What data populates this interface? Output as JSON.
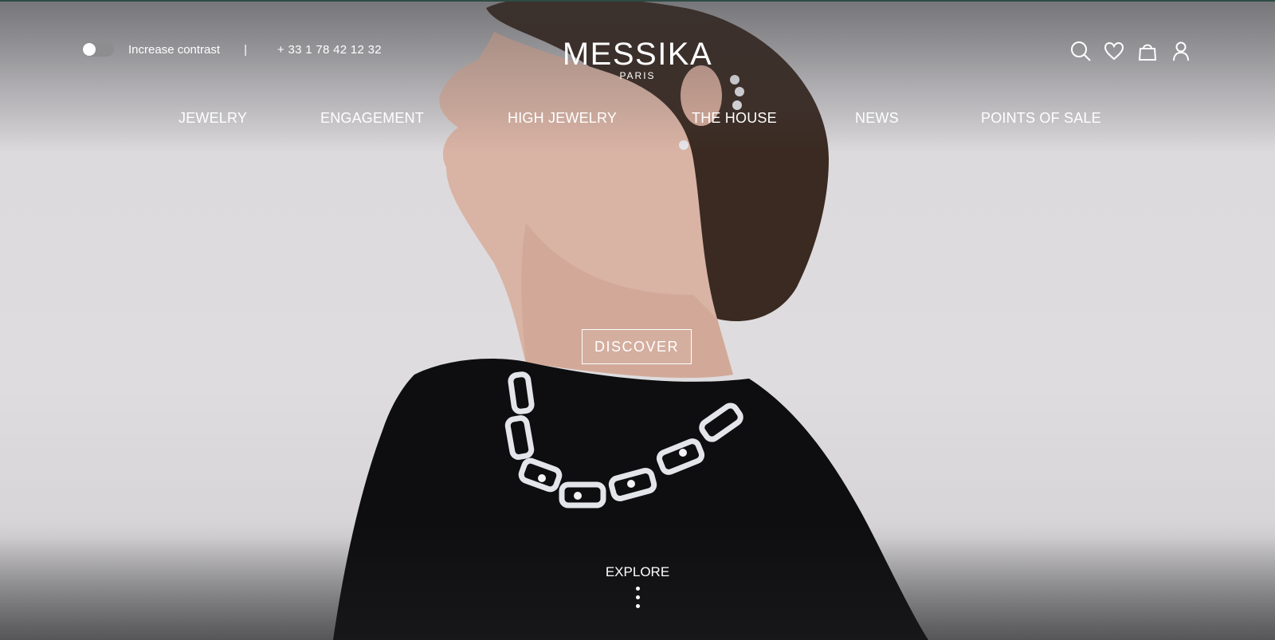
{
  "header": {
    "contrast_toggle_label": "Increase contrast",
    "separator": "|",
    "phone": "+ 33 1 78 42 12 32",
    "logo": {
      "name": "MESSIKA",
      "sub": "PARIS"
    },
    "icons": [
      "search-icon",
      "heart-icon",
      "bag-icon",
      "user-icon"
    ]
  },
  "nav": {
    "items": [
      {
        "label": "JEWELRY"
      },
      {
        "label": "ENGAGEMENT"
      },
      {
        "label": "HIGH JEWELRY"
      },
      {
        "label": "THE HOUSE"
      },
      {
        "label": "NEWS"
      },
      {
        "label": "POINTS OF SALE"
      }
    ]
  },
  "hero": {
    "cta_label": "DISCOVER",
    "explore_label": "EXPLORE"
  },
  "colors": {
    "text": "#ffffff",
    "background": "#dedcde",
    "sweater": "#0e0e10"
  }
}
